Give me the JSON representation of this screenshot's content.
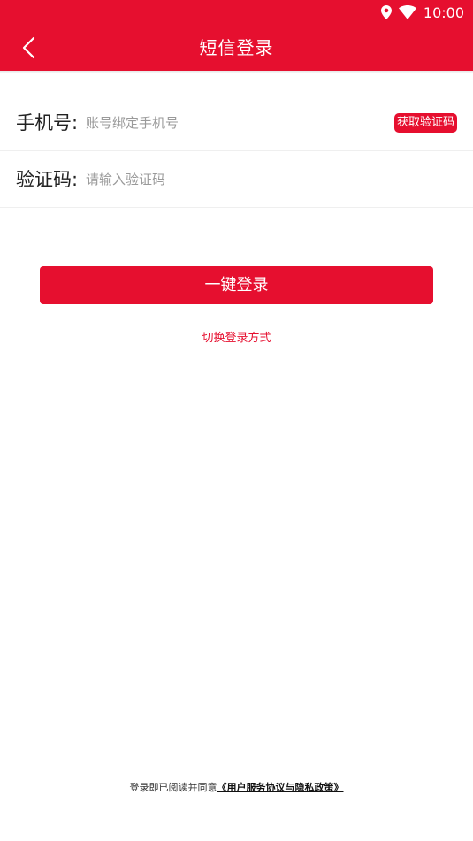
{
  "status_bar": {
    "time": "10:00",
    "background_color": "#e60f2f"
  },
  "header": {
    "title": "短信登录",
    "back_icon": "chevron-left-icon"
  },
  "form": {
    "phone": {
      "label": "手机号:",
      "placeholder": "账号绑定手机号",
      "value": ""
    },
    "get_code_button": "获取验证码",
    "code": {
      "label": "验证码:",
      "placeholder": "请输入验证码",
      "value": ""
    }
  },
  "actions": {
    "login_button": "一键登录",
    "switch_login": "切换登录方式"
  },
  "footer": {
    "agreement_prefix": "登录即已阅读并同意",
    "agreement_link": "《用户服务协议与隐私政策》"
  },
  "colors": {
    "primary": "#e60f2f",
    "placeholder": "#9a9a9a"
  }
}
